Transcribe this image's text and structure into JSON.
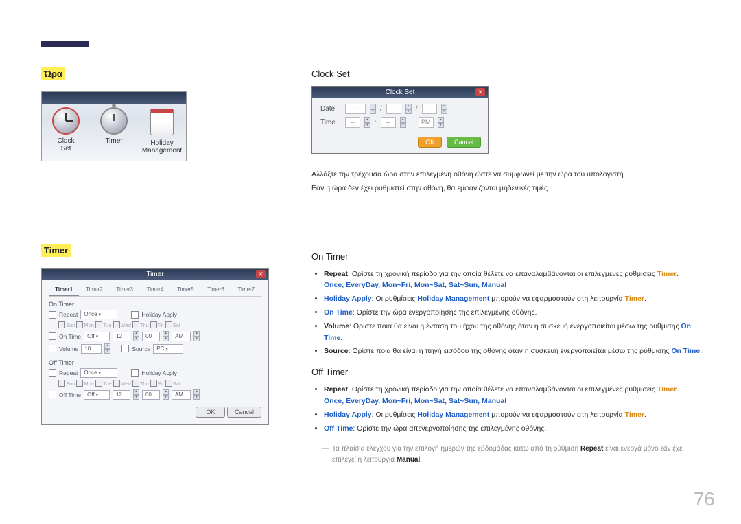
{
  "page_number": "76",
  "left": {
    "section_time": "Ώρα",
    "section_timer": "Timer",
    "icons": {
      "clock": "Clock\nSet",
      "timer": "Timer",
      "holiday": "Holiday\nManagement"
    }
  },
  "clockset": {
    "heading": "Clock Set",
    "dialog_title": "Clock Set",
    "date_label": "Date",
    "time_label": "Time",
    "placeholder_dash": "----",
    "placeholder_dd": "--",
    "ampm": "PM",
    "ok": "OK",
    "cancel": "Cancel",
    "desc1": "Αλλάξτε την τρέχουσα ώρα στην επιλεγμένη οθόνη ώστε να συμφωνεί με την ώρα του υπολογιστή.",
    "desc2": "Εάν η ώρα δεν έχει ρυθμιστεί στην οθόνη, θα εμφανίζονται μηδενικές τιμές."
  },
  "timer_dlg": {
    "title": "Timer",
    "close": "✕",
    "tabs": [
      "Timer1",
      "Timer2",
      "Timer3",
      "Timer4",
      "Timer5",
      "Timer6",
      "Timer7"
    ],
    "group_on": "On Timer",
    "group_off": "Off Timer",
    "repeat_label": "Repeat",
    "repeat_value": "Once",
    "holiday_apply": "Holiday Apply",
    "days": [
      "Sun",
      "Mon",
      "Tue",
      "Wed",
      "Thu",
      "Fri",
      "Sat"
    ],
    "on_time_label": "On Time",
    "off_time_label": "Off Time",
    "on_time_enabled": "Off",
    "hour": "12",
    "min": "00",
    "ampm": "AM",
    "volume_label": "Volume",
    "volume_value": "10",
    "source_label": "Source",
    "source_value": "PC",
    "ok": "OK",
    "cancel": "Cancel"
  },
  "on_timer": {
    "heading": "On Timer",
    "b1_lead": "Repeat",
    "b1_rest": ": Ορίστε τη χρονική περίοδο για την οποία θέλετε να επαναλαμβάνονται οι επιλεγμένες ρυθμίσεις ",
    "b1_tail": "Timer",
    "options": "Once, EveryDay, Mon~Fri, Mon~Sat, Sat~Sun, Manual",
    "b2_lead": "Holiday Apply",
    "b2_mid": ": Οι ρυθμίσεις ",
    "b2_hm": "Holiday Management",
    "b2_rest": " μπορούν να εφαρμοστούν στη λειτουργία ",
    "b2_tail": "Timer",
    "b3_lead": "On Time",
    "b3_rest": ": Ορίστε την ώρα ενεργοποίησης της επιλεγμένης οθόνης.",
    "b4_lead": "Volume",
    "b4_rest": ": Ορίστε ποια θα είναι η ένταση του ήχου της οθόνης όταν η συσκευή ενεργοποιείται μέσω της ρύθμισης ",
    "b4_tail": "On Time",
    "b5_lead": "Source",
    "b5_rest": ": Ορίστε ποια θα είναι η πηγή εισόδου της οθόνης όταν η συσκευή ενεργοποιείται μέσω της ρύθμισης ",
    "b5_tail": "On Time"
  },
  "off_timer": {
    "heading": "Off Timer",
    "b1_lead": "Repeat",
    "b1_rest": ": Ορίστε τη χρονική περίοδο για την οποία θέλετε να επαναλαμβάνονται οι επιλεγμένες ρυθμίσεις ",
    "b1_tail": "Timer",
    "options": "Once, EveryDay, Mon~Fri, Mon~Sat, Sat~Sun, Manual",
    "b2_lead": "Holiday Apply",
    "b2_mid": ": Οι ρυθμίσεις ",
    "b2_hm": "Holiday Management",
    "b2_rest": " μπορούν να εφαρμοστούν στη λειτουργία ",
    "b2_tail": "Timer",
    "b3_lead": "Off Time",
    "b3_rest": ": Ορίστε την ώρα απενεργοποίησης της επιλεγμένης οθόνης.",
    "note_a": "Τα πλαίσια ελέγχου για την επιλογή ημερών της εβδομάδας κάτω από τη ρύθμιση ",
    "note_repeat": "Repeat",
    "note_b": " είναι ενεργά μόνο εάν έχει επιλεγεί η λειτουργία ",
    "note_manual": "Manual"
  }
}
